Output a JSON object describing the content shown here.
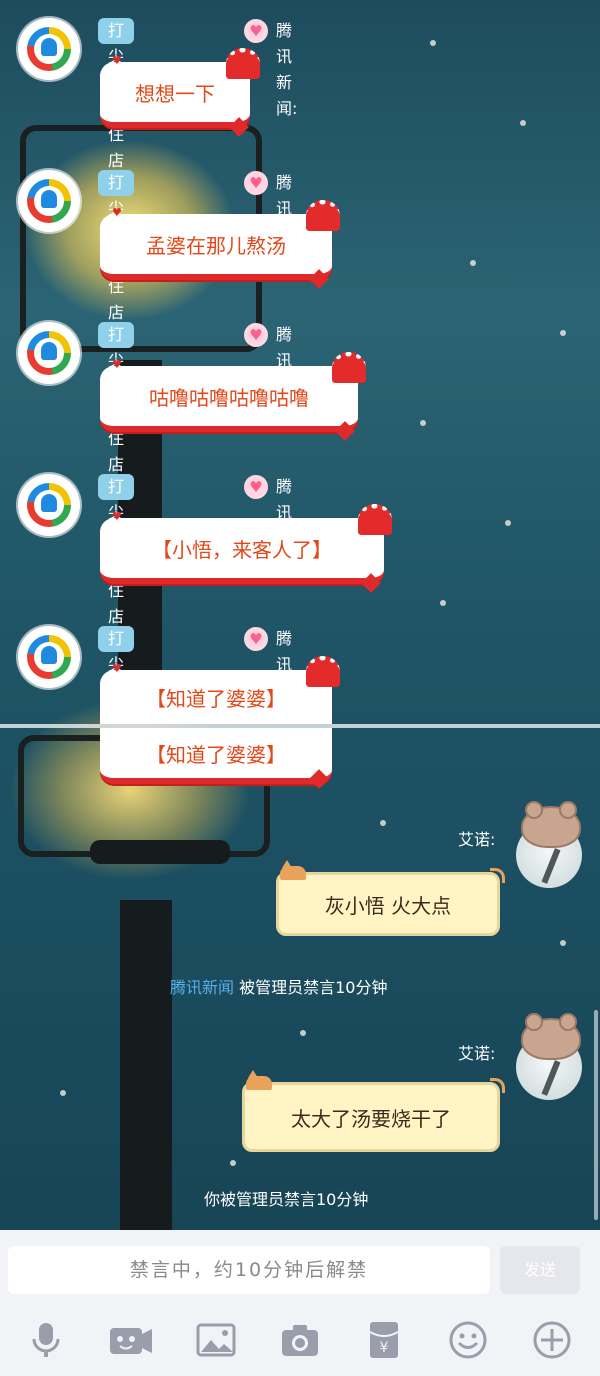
{
  "chat": {
    "top_messages": [
      {
        "tag": "打尖还是住店",
        "sender": "腾讯新闻:",
        "text": "想想一下"
      },
      {
        "tag": "打尖还是住店",
        "sender": "腾讯新闻:",
        "text": "孟婆在那儿熬汤"
      },
      {
        "tag": "打尖还是住店",
        "sender": "腾讯新闻:",
        "text": "咕噜咕噜咕噜咕噜"
      },
      {
        "tag": "打尖还是住店",
        "sender": "腾讯新闻:",
        "text": "【小悟，来客人了】"
      },
      {
        "tag": "打尖还是住店",
        "sender": "腾讯新闻:",
        "text": "【知道了婆婆】"
      }
    ],
    "repeat_text": "【知道了婆婆】",
    "right_messages": [
      {
        "name": "艾诺:",
        "text": "灰小悟 火大点"
      },
      {
        "name": "艾诺:",
        "text": "太大了汤要烧干了"
      }
    ],
    "system_1": {
      "who": "腾讯新闻",
      "text": "被管理员禁言10分钟"
    },
    "system_2": {
      "text": "你被管理员禁言10分钟"
    }
  },
  "input": {
    "muted_placeholder": "禁言中，约10分钟后解禁",
    "send_label": "发送"
  },
  "toolbar": {
    "icons": [
      "microphone-icon",
      "video-icon",
      "image-icon",
      "camera-icon",
      "red-packet-icon",
      "emoji-icon",
      "plus-icon"
    ]
  },
  "colors": {
    "bubble_text": "#e24818",
    "tag_bg": "#8fd1ea",
    "system_name": "#5aaee8"
  }
}
